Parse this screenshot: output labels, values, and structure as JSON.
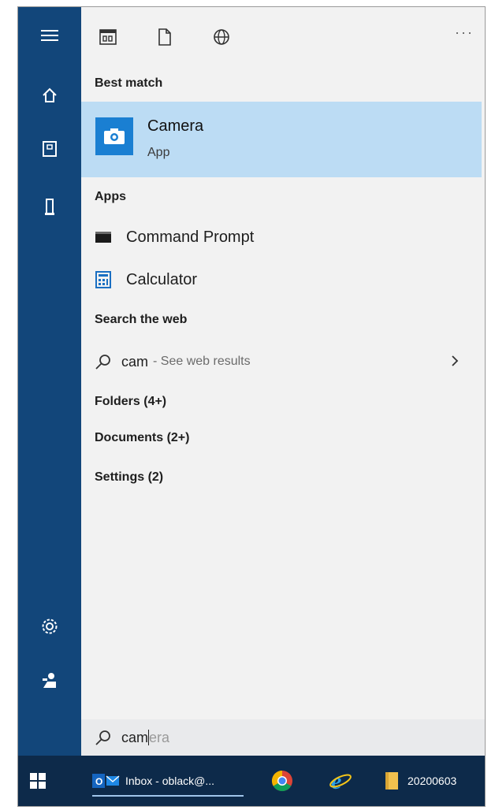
{
  "toolbar": {
    "icons": [
      "apps-icon",
      "document-icon",
      "globe-icon"
    ],
    "more_label": "···"
  },
  "sidebar": {
    "icons": [
      "hamburger-menu-icon",
      "home-icon",
      "notebook-icon",
      "tower-icon",
      "settings-gear-icon",
      "user-feedback-icon"
    ]
  },
  "results": {
    "best_match_heading": "Best match",
    "best_match": {
      "title": "Camera",
      "subtitle": "App",
      "icon": "camera-icon"
    },
    "apps_heading": "Apps",
    "apps": [
      {
        "label": "Command Prompt",
        "icon": "command-prompt-icon"
      },
      {
        "label": "Calculator",
        "icon": "calculator-icon"
      }
    ],
    "web_heading": "Search the web",
    "web": {
      "query": "cam",
      "suffix": "- See web results"
    },
    "categories": [
      "Folders (4+)",
      "Documents (2+)",
      "Settings (2)"
    ]
  },
  "search": {
    "typed": "cam",
    "suggestion": "era"
  },
  "taskbar": {
    "outlook_label": "Inbox - oblack@...",
    "folder_label": "20200603"
  },
  "colors": {
    "rail": "#12467a",
    "highlight": "#bcdcf4",
    "accent": "#1a7fd2",
    "taskbar": "#0d2a4a"
  }
}
